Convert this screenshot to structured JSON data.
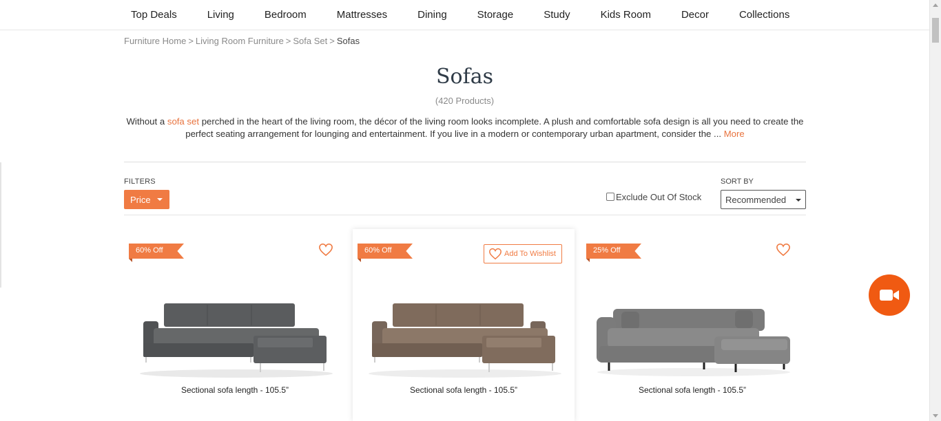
{
  "nav": {
    "items": [
      "Top Deals",
      "Living",
      "Bedroom",
      "Mattresses",
      "Dining",
      "Storage",
      "Study",
      "Kids Room",
      "Decor",
      "Collections"
    ]
  },
  "breadcrumb": {
    "items": [
      "Furniture Home",
      "Living Room Furniture",
      "Sofa Set"
    ],
    "current": "Sofas",
    "separator": ">"
  },
  "page": {
    "title": "Sofas",
    "count": "(420 Products)",
    "desc_pre": "Without a ",
    "desc_link": "sofa set",
    "desc_post": " perched in the heart of the living room, the décor of the living room looks incomplete. A plush and comfortable sofa design is all you need to create the perfect seating arrangement for lounging and entertainment. If you live in a modern or contemporary urban apartment, consider the ... ",
    "desc_more": "More"
  },
  "filters": {
    "label": "FILTERS",
    "price_label": "Price",
    "exclude_oos_label": "Exclude Out Of Stock",
    "exclude_oos_checked": false
  },
  "sort": {
    "label": "SORT BY",
    "selected": "Recommended"
  },
  "products": [
    {
      "badge": "60% Off",
      "name": "Sectional sofa length - 105.5”",
      "color": "#5f6163"
    },
    {
      "badge": "60% Off",
      "name": "Sectional sofa length - 105.5”",
      "color": "#8a7565",
      "wishlist_label": "Add To Wishlist"
    },
    {
      "badge": "25% Off",
      "name": "Sectional sofa length - 105.5”",
      "color": "#808080"
    }
  ],
  "colors": {
    "accent": "#f07b43",
    "video_button": "#f05a12"
  }
}
